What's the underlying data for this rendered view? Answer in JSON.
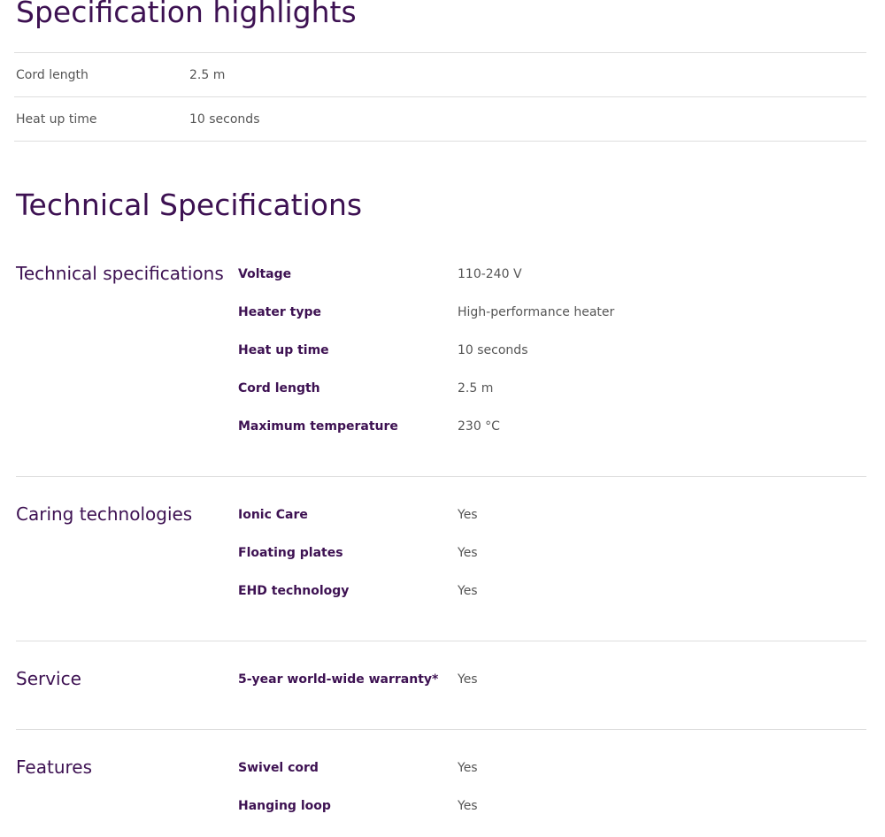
{
  "highlights": {
    "title": "Specification highlights",
    "rows": [
      {
        "label": "Cord length",
        "value": "2.5  m"
      },
      {
        "label": "Heat up time",
        "value": "10 seconds"
      }
    ]
  },
  "technical": {
    "title": "Technical Specifications",
    "groups": [
      {
        "title": "Technical specifications",
        "rows": [
          {
            "label": "Voltage",
            "value": "110-240  V"
          },
          {
            "label": "Heater type",
            "value": "High-performance heater"
          },
          {
            "label": "Heat up time",
            "value": "10 seconds"
          },
          {
            "label": "Cord length",
            "value": "2.5  m"
          },
          {
            "label": "Maximum temperature",
            "value": "230  °C"
          }
        ]
      },
      {
        "title": "Caring technologies",
        "rows": [
          {
            "label": "Ionic Care",
            "value": "Yes"
          },
          {
            "label": "Floating plates",
            "value": "Yes"
          },
          {
            "label": "EHD technology",
            "value": "Yes"
          }
        ]
      },
      {
        "title": "Service",
        "rows": [
          {
            "label": "5-year world-wide warranty*",
            "value": "Yes"
          }
        ]
      },
      {
        "title": "Features",
        "rows": [
          {
            "label": "Swivel cord",
            "value": "Yes"
          },
          {
            "label": "Hanging loop",
            "value": "Yes"
          }
        ]
      }
    ]
  }
}
